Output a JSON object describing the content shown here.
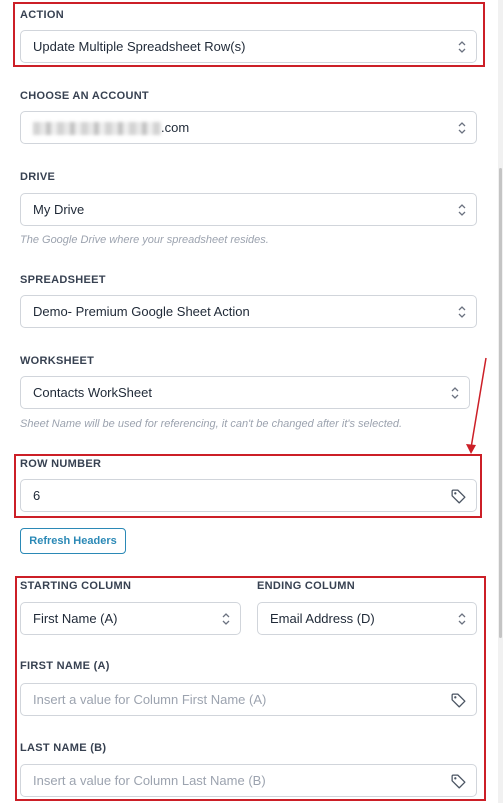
{
  "action": {
    "label": "ACTION",
    "value": "Update Multiple Spreadsheet Row(s)"
  },
  "account": {
    "label": "CHOOSE AN ACCOUNT",
    "value_suffix": ".com"
  },
  "drive": {
    "label": "DRIVE",
    "value": "My Drive",
    "hint": "The Google Drive where your spreadsheet resides."
  },
  "spreadsheet": {
    "label": "SPREADSHEET",
    "value": "Demo- Premium Google Sheet Action"
  },
  "worksheet": {
    "label": "WORKSHEET",
    "value": "Contacts WorkSheet",
    "hint": "Sheet Name will be used for referencing, it can't be changed after it's selected."
  },
  "row_number": {
    "label": "ROW NUMBER",
    "value": "6"
  },
  "refresh_button": {
    "label": "Refresh Headers"
  },
  "starting_column": {
    "label": "STARTING COLUMN",
    "value": "First Name (A)"
  },
  "ending_column": {
    "label": "ENDING COLUMN",
    "value": "Email Address (D)"
  },
  "first_name": {
    "label": "FIRST NAME (A)",
    "placeholder": "Insert a value for Column First Name (A)"
  },
  "last_name": {
    "label": "LAST NAME (B)",
    "placeholder": "Insert a value for Column Last Name (B)"
  },
  "colors": {
    "highlight": "#cc1f27",
    "accent": "#2b89b6",
    "border": "#d1d5db"
  },
  "icons": {
    "select": "chevron-up-down-icon",
    "variable": "tag-icon"
  }
}
